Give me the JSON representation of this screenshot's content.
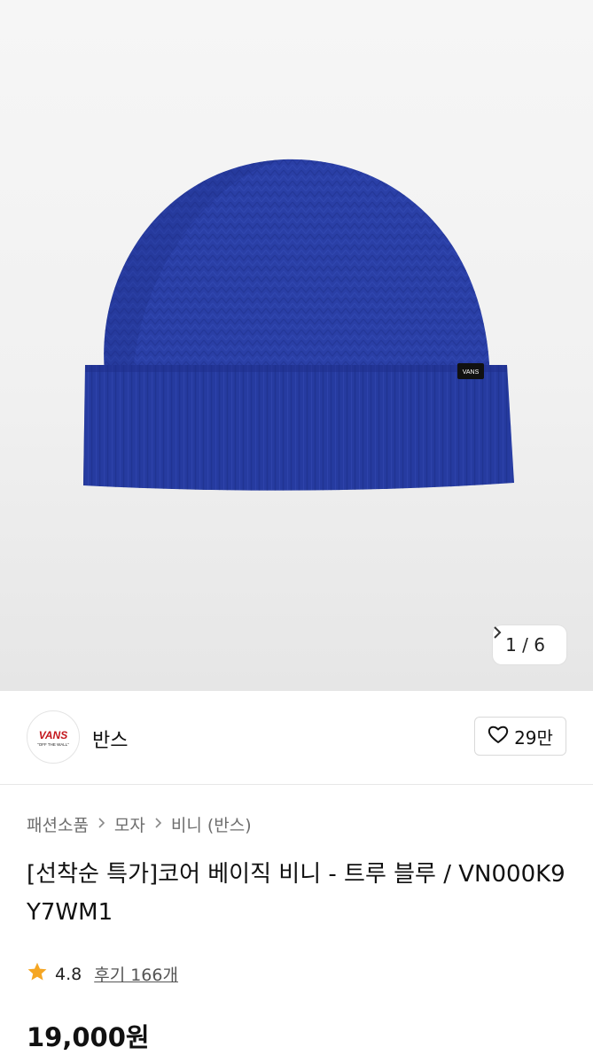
{
  "gallery": {
    "current": "1",
    "separator": "/",
    "total": "6",
    "next_icon": "chevron-right-icon"
  },
  "brand": {
    "logo_text": "VANS",
    "logo_subtext": "\"OFF THE WALL\"",
    "logo_color": "#c3161c",
    "name": "반스",
    "likes": "29만",
    "like_icon": "heart-outline-icon"
  },
  "breadcrumb": {
    "items": [
      "패션소품",
      "모자",
      "비니 (반스)"
    ],
    "separator_icon": "chevron-right-icon"
  },
  "product": {
    "title": "[선착순 특가]코어 베이직 비니 - 트루 블루 / VN000K9Y7WM1",
    "color": "#2a3fa6",
    "label_text": "VANS"
  },
  "rating": {
    "score": "4.8",
    "reviews": "후기 166개",
    "star_color": "#f5a623"
  },
  "price": {
    "value": "19,000원"
  }
}
